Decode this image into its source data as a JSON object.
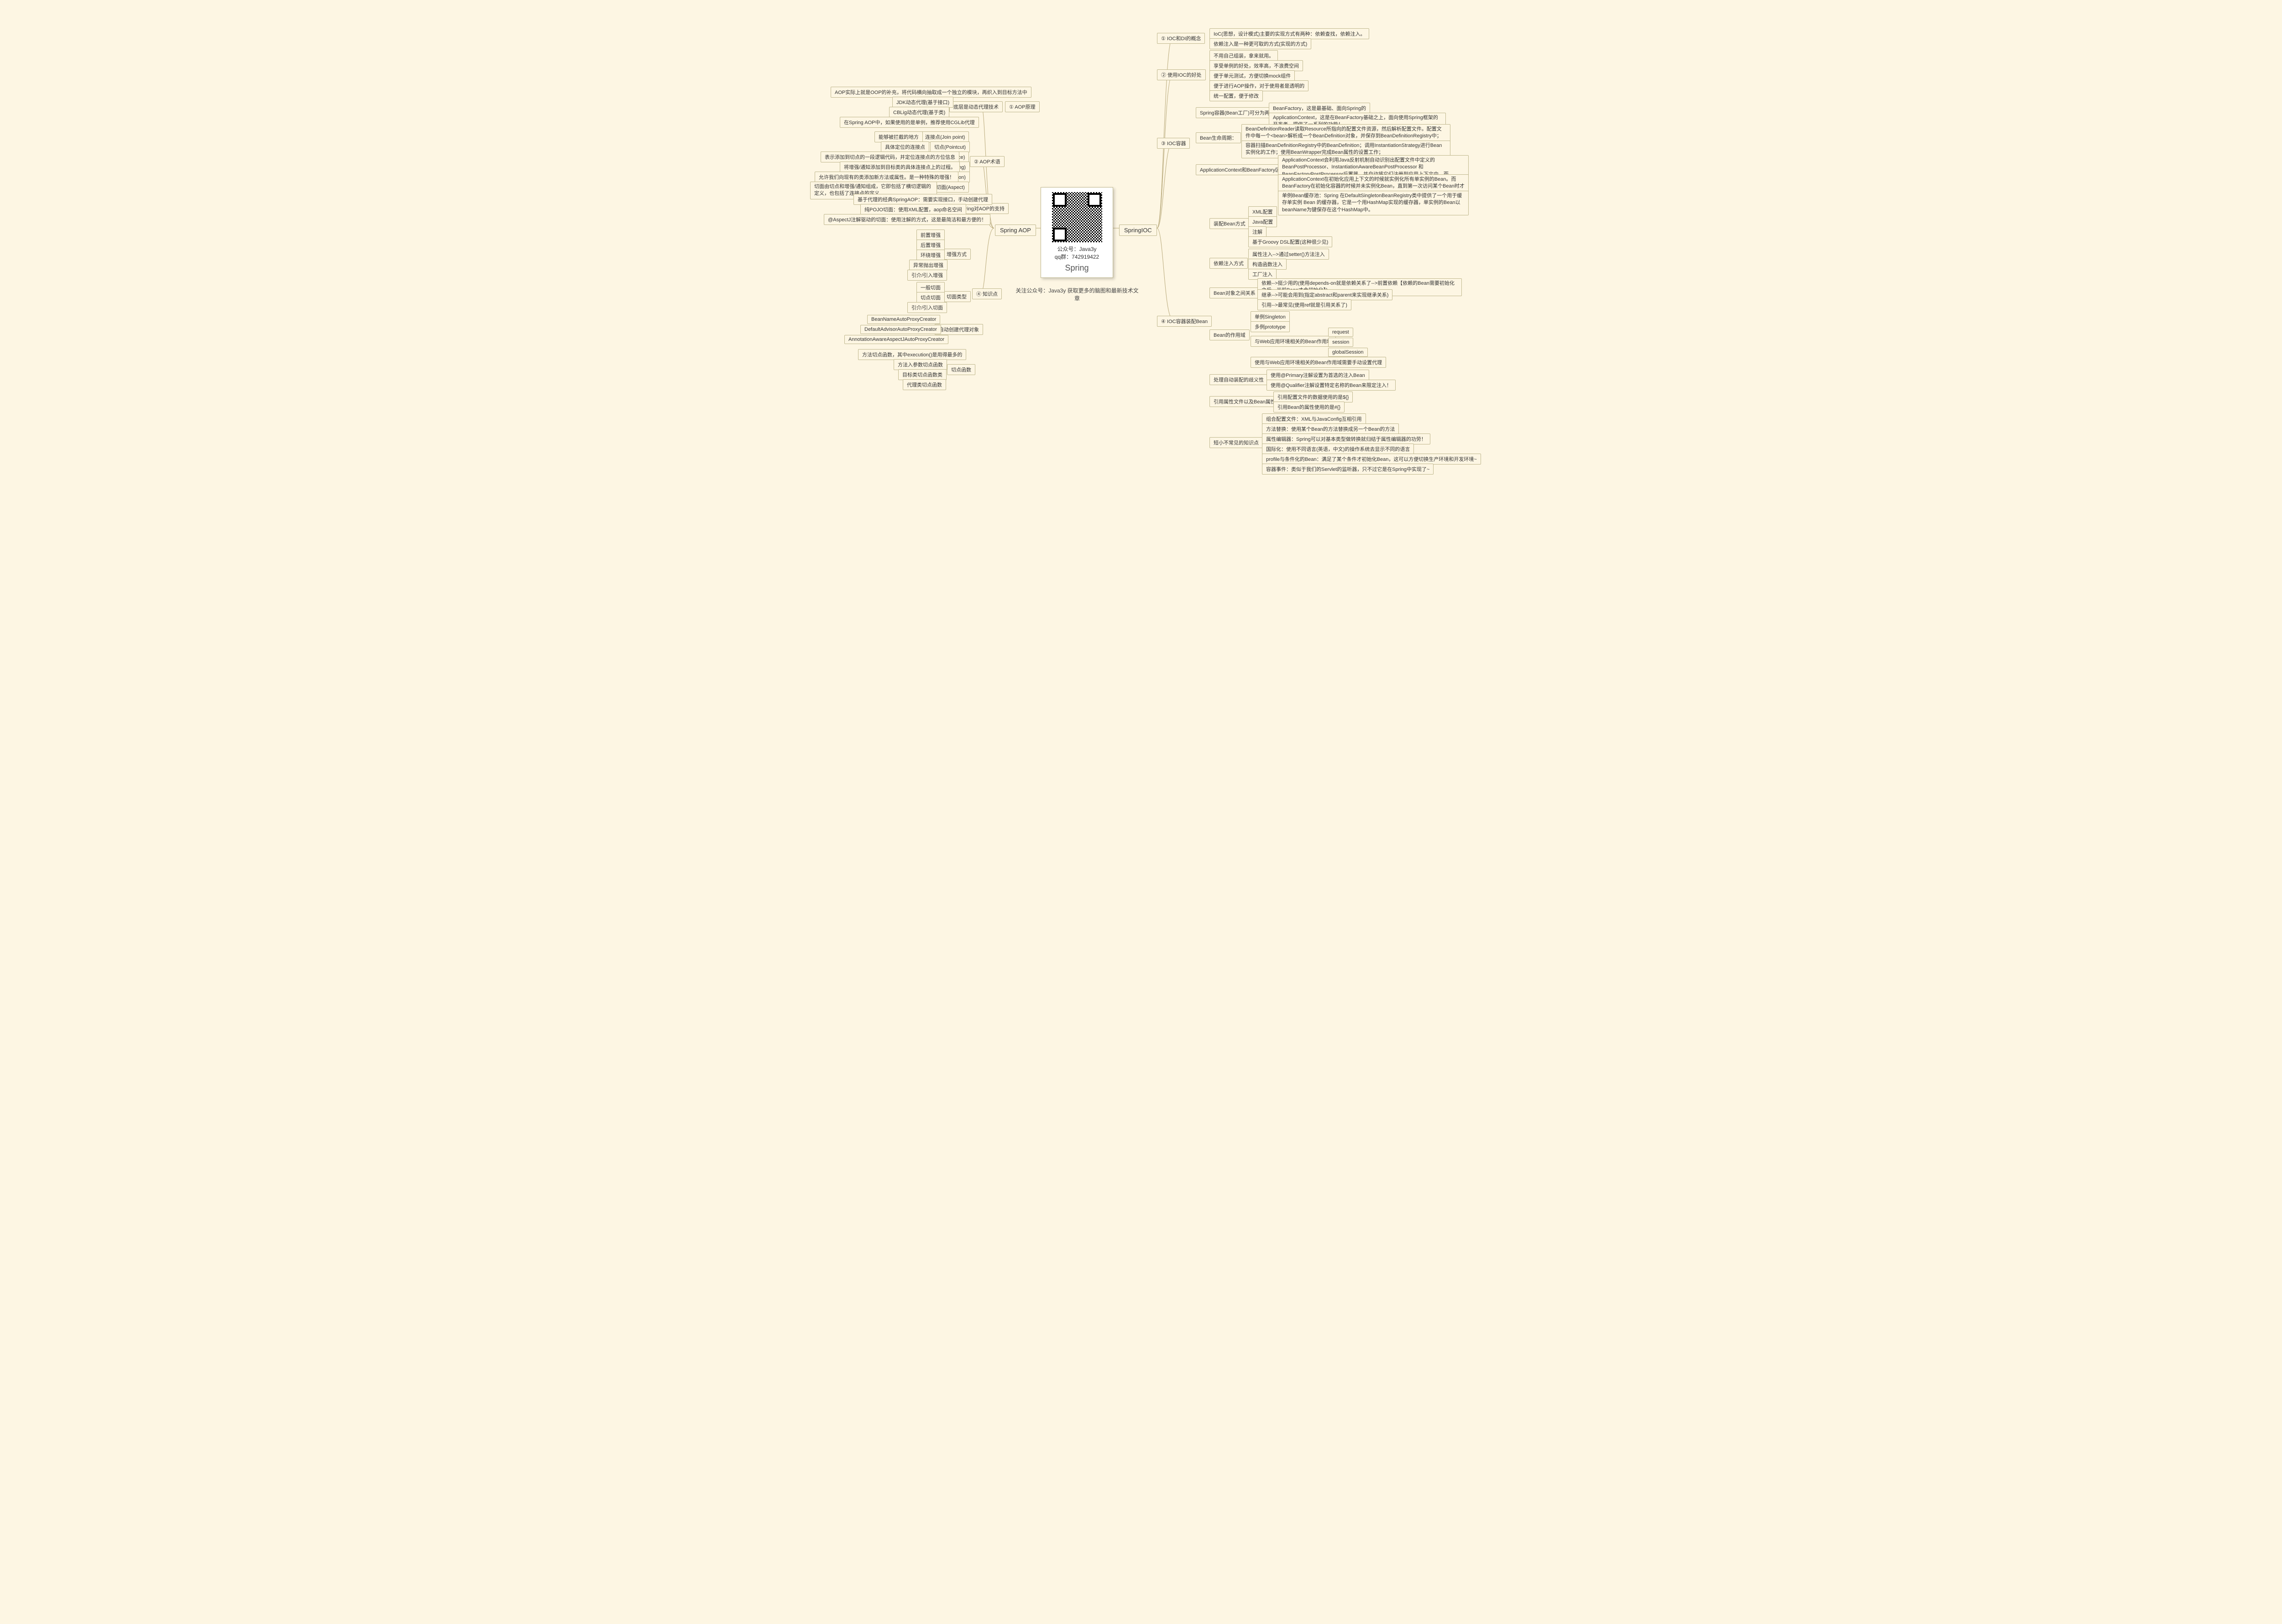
{
  "root": {
    "title": "Spring",
    "wechat_label": "公众号：Java3y",
    "qq_label": "qq群：742919422",
    "caption": "关注公众号：Java3y 获取更多的脑图和最新技术文章"
  },
  "left": {
    "branch": "Spring AOP",
    "sections": {
      "aop_principle": {
        "label": "① AOP原理",
        "proxy_tech": "底层是动态代理技术",
        "items": [
          "AOP实际上就是OOP的补充，将代码横向抽取成一个独立的模块，再织入到目标方法中",
          "JDK动态代理(基于接口)",
          "CBLig动态代理(基于类)",
          "在Spring AOP中，如果使用的是单例，推荐使用CGLib代理"
        ]
      },
      "aop_terms": {
        "label": "② AOP术语",
        "items": [
          {
            "text": "能够被拦截的地方",
            "term": "连接点(Join point)"
          },
          {
            "text": "具体定位的连接点",
            "term": "切点(Pointcut)"
          },
          {
            "text": "表示添加到切点的一段逻辑代码，并定位连接点的方位信息",
            "term": "增强/通知(Advice)"
          },
          {
            "text": "将增强/通知添加到目标类的具体连接点上的过程。",
            "term": "织入(Weaving)"
          },
          {
            "text": "允许我们向现有的类添加新方法或属性。是一种特殊的增强！",
            "term": "引入/引介(Introduction)"
          },
          {
            "text": "切面由切点和增强/通知组成，它即包括了横切逻辑的定义，也包括了连接点的定义",
            "term": "切面(Aspect)"
          }
        ]
      },
      "aop_support": {
        "label": "③ Spring对AOP的支持",
        "items": [
          "基于代理的经典SpringAOP：需要实现接口，手动创建代理",
          "纯POJO切面：使用XML配置，aop命名空间",
          "@AspectJ注解驱动的切面：使用注解的方式，这是最简洁和最方便的！"
        ]
      },
      "knowledge": {
        "label": "④ 知识点",
        "enhance_type": {
          "label": "增强方式",
          "items": [
            "前置增强",
            "后置增强",
            "环绕增强",
            "异常抛出增强",
            "引介/引入增强"
          ]
        },
        "aspect_type": {
          "label": "切面类型",
          "items": [
            "一般切面",
            "切点切面",
            "引介/引入切面"
          ]
        },
        "auto_proxy": {
          "label": "自动创建代理对象",
          "items": [
            "BeanNameAutoProxyCreator",
            "DefaultAdvisorAutoProxyCreator",
            "AnnotationAwareAspectJAutoProxyCreator"
          ]
        },
        "pointcut_fn": {
          "label": "切点函数",
          "items": [
            "方法切点函数，其中execution()是用得最多的",
            "方法入参数切点函数",
            "目标类切点函数类",
            "代理类切点函数"
          ]
        }
      }
    }
  },
  "right": {
    "branch": "SpringIOC",
    "sections": {
      "s1": {
        "label": "① IOC和DI的概念",
        "items": [
          "IoC(思想，设计模式)主要的实现方式有两种：依赖查找，依赖注入。",
          "依赖注入是一种更可取的方式(实现的方式)"
        ]
      },
      "s2": {
        "label": "② 使用IOC的好处",
        "items": [
          "不用自己组装，拿来就用。",
          "享受单例的好处，效率高，不浪费空间",
          "便于单元测试，方便切换mock组件",
          "便于进行AOP操作，对于使用者是透明的",
          "统一配置，便于修改"
        ]
      },
      "s3": {
        "label": "③ IOC容器",
        "factory": {
          "label": "Spring容器(Bean工厂)可分为两种：",
          "items": [
            "BeanFactory，这是最基础、面向Spring的",
            "ApplicationContext，这是在BeanFactory基础之上，面向使用Spring框架的开发者。提供了一系列的功能！"
          ]
        },
        "lifecycle": {
          "label": "Bean生命周期：",
          "items": [
            "BeanDefinitionReader读取Resource所指向的配置文件资源，然后解析配置文件。配置文件中每一个<bean>解析成一个BeanDefinition对象，并保存到BeanDefinitionRegistry中；",
            "容器扫描BeanDefinitionRegistry中的BeanDefinition；调用InstantiationStrategy进行Bean实例化的工作；使用BeanWrapper完成Bean属性的设置工作；"
          ]
        },
        "diff": {
          "label": "ApplicationContext和BeanFactory区别",
          "items": [
            "ApplicationContext会利用Java反射机制自动识别出配置文件中定义的BeanPostProcessor、InstantiationAwareBeanPostProcessor 和BeanFactoryPostProcessor后置器，并自动将它们注册到应用上下文中。而BeanFactory需要在代码中通过手工调用addBeanPostProcessor()方法进行注册",
            "ApplicationContext在初始化应用上下文的时候就实例化所有单实例的Bean。而BeanFactory在初始化容器的时候并未实例化Bean，直到第一次访问某个Bean时才实例化目标Bean。"
          ]
        },
        "cache": "单例Bean缓存池：Spring 在DefaultSingletonBeanRegistry类中提供了一个用于缓存单实例 Bean 的缓存器，它是一个用HashMap实现的缓存器，单实例的Bean以beanName为键保存在这个HashMap中。"
      },
      "s4": {
        "label": "④ IOC容器装配Bean",
        "config": {
          "label": "装配Bean方式",
          "items": [
            "XML配置",
            "Java配置",
            "注解",
            "基于Groovy DSL配置(这种很少见)"
          ]
        },
        "inject": {
          "label": "依赖注入方式",
          "items": [
            "属性注入-->通过setter()方法注入",
            "构造函数注入",
            "工厂注入"
          ]
        },
        "relation": {
          "label": "Bean对象之间关系",
          "items": [
            "依赖-->挺少用的(使用depends-on就是依赖关系了-->前置依赖【依赖的Bean需要初始化之后，当前Bean才会初始化】)",
            "继承-->可能会用到(指定abstract和parent来实现继承关系)",
            "引用-->最常见(使用ref就是引用关系了)"
          ]
        },
        "scope": {
          "label": "Bean的作用域",
          "items": [
            "单例Singleton",
            "多例prototype"
          ],
          "web": {
            "label": "与Web应用环境相关的Bean作用域",
            "items": [
              "request",
              "session",
              "globalSession"
            ]
          },
          "note": "使用与Web应用环境相关的Bean作用域需要手动设置代理"
        },
        "ambiguity": {
          "label": "处理自动装配的歧义性",
          "items": [
            "使用@Primary注解设置为首选的注入Bean",
            "使用@Qualifier注解设置特定名称的Bean来限定注入！"
          ]
        },
        "ref": {
          "label": "引用属性文件以及Bean属性",
          "items": [
            "引用配置文件的数据使用的是${}",
            "引用Bean的属性使用的是#{}"
          ]
        },
        "misc": {
          "label": "短小不常见的知识点",
          "items": [
            "组合配置文件：XML与JavaConfig互相引用",
            "方法替换：使用某个Bean的方法替换成另一个Bean的方法",
            "属性编辑器：Spring可以对基本类型做转换就归结于属性编辑器的功劳！",
            "国际化：使用不同语言(英语，中文)的操作系统去显示不同的语言",
            "profile与条件化的Bean：满足了某个条件才初始化Bean，这可以方便切换生产环境和开发环境~",
            "容器事件：类似于我们的Servlet的监听器，只不过它是在Spring中实现了~"
          ]
        }
      }
    }
  }
}
